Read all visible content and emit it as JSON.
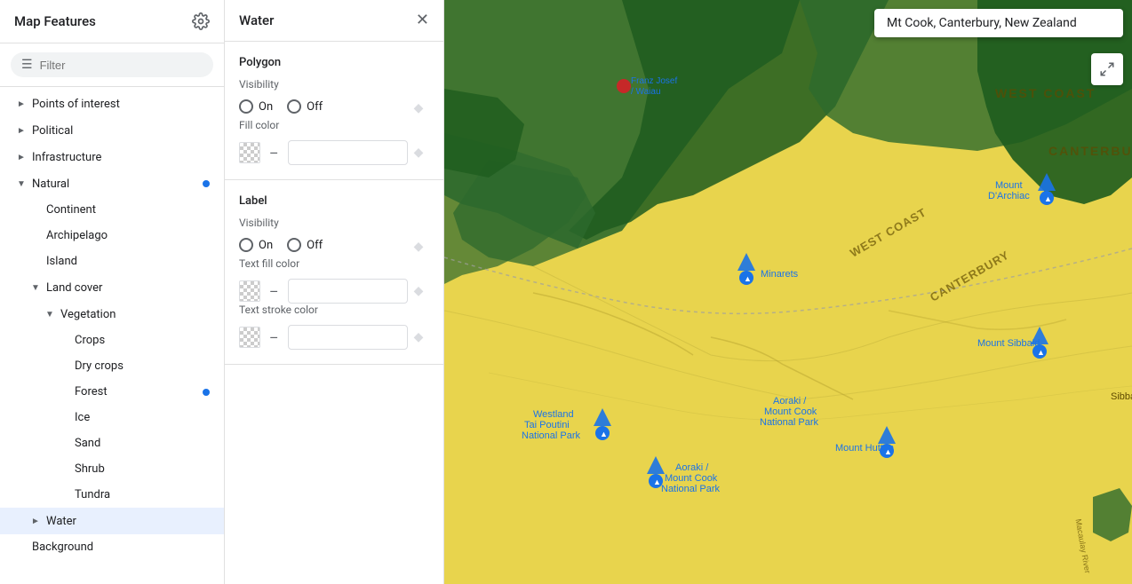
{
  "leftPanel": {
    "title": "Map Features",
    "filter": {
      "placeholder": "Filter",
      "value": ""
    },
    "tree": [
      {
        "id": "points-of-interest",
        "label": "Points of interest",
        "indent": 0,
        "hasChevron": true,
        "chevronDir": "right",
        "hasDot": false
      },
      {
        "id": "political",
        "label": "Political",
        "indent": 0,
        "hasChevron": true,
        "chevronDir": "right",
        "hasDot": false
      },
      {
        "id": "infrastructure",
        "label": "Infrastructure",
        "indent": 0,
        "hasChevron": true,
        "chevronDir": "right",
        "hasDot": false
      },
      {
        "id": "natural",
        "label": "Natural",
        "indent": 0,
        "hasChevron": true,
        "chevronDir": "down",
        "hasDot": true
      },
      {
        "id": "continent",
        "label": "Continent",
        "indent": 1,
        "hasChevron": false,
        "hasDot": false
      },
      {
        "id": "archipelago",
        "label": "Archipelago",
        "indent": 1,
        "hasChevron": false,
        "hasDot": false
      },
      {
        "id": "island",
        "label": "Island",
        "indent": 1,
        "hasChevron": false,
        "hasDot": false
      },
      {
        "id": "land-cover",
        "label": "Land cover",
        "indent": 1,
        "hasChevron": true,
        "chevronDir": "down",
        "hasDot": false
      },
      {
        "id": "vegetation",
        "label": "Vegetation",
        "indent": 2,
        "hasChevron": true,
        "chevronDir": "down",
        "hasDot": false
      },
      {
        "id": "crops",
        "label": "Crops",
        "indent": 3,
        "hasChevron": false,
        "hasDot": false
      },
      {
        "id": "dry-crops",
        "label": "Dry crops",
        "indent": 3,
        "hasChevron": false,
        "hasDot": false
      },
      {
        "id": "forest",
        "label": "Forest",
        "indent": 3,
        "hasChevron": false,
        "hasDot": true
      },
      {
        "id": "ice",
        "label": "Ice",
        "indent": 3,
        "hasChevron": false,
        "hasDot": false
      },
      {
        "id": "sand",
        "label": "Sand",
        "indent": 3,
        "hasChevron": false,
        "hasDot": false
      },
      {
        "id": "shrub",
        "label": "Shrub",
        "indent": 3,
        "hasChevron": false,
        "hasDot": false
      },
      {
        "id": "tundra",
        "label": "Tundra",
        "indent": 3,
        "hasChevron": false,
        "hasDot": false
      },
      {
        "id": "water",
        "label": "Water",
        "indent": 1,
        "hasChevron": true,
        "chevronDir": "right",
        "selected": true,
        "hasDot": false
      },
      {
        "id": "background",
        "label": "Background",
        "indent": 0,
        "hasChevron": false,
        "hasDot": false
      }
    ]
  },
  "middlePanel": {
    "title": "Water",
    "sections": [
      {
        "id": "polygon",
        "name": "Polygon",
        "fields": [
          {
            "id": "polygon-visibility",
            "label": "Visibility",
            "type": "radio",
            "options": [
              "On",
              "Off"
            ]
          },
          {
            "id": "polygon-fill-color",
            "label": "Fill color",
            "type": "color"
          }
        ]
      },
      {
        "id": "label",
        "name": "Label",
        "fields": [
          {
            "id": "label-visibility",
            "label": "Visibility",
            "type": "radio",
            "options": [
              "On",
              "Off"
            ]
          },
          {
            "id": "label-text-fill-color",
            "label": "Text fill color",
            "type": "color"
          },
          {
            "id": "label-text-stroke-color",
            "label": "Text stroke color",
            "type": "color"
          }
        ]
      }
    ]
  },
  "map": {
    "searchValue": "Mt Cook, Canterbury, New Zealand",
    "accentColor": "#1a73e8",
    "expandIcon": "⤢"
  }
}
